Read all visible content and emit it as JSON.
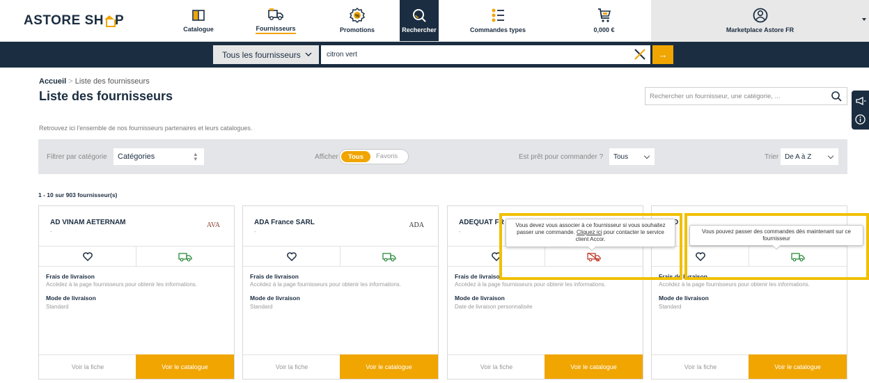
{
  "brand": {
    "logo_left": "ASTORE SH",
    "logo_right": "P"
  },
  "nav": {
    "catalogue": "Catalogue",
    "fournisseurs": "Fournisseurs",
    "promotions": "Promotions",
    "rechercher": "Rechercher",
    "commandes_types": "Commandes types",
    "cart_amount": "0,000 €",
    "user": "Marketplace Astore FR"
  },
  "search": {
    "scope": "Tous les fournisseurs",
    "query": "citron vert",
    "go": "→"
  },
  "page": {
    "breadcrumb_home": "Accueil",
    "breadcrumb_sep": ">",
    "breadcrumb_current": "Liste des fournisseurs",
    "title": "Liste des fournisseurs",
    "supplier_search_placeholder": "Rechercher un fournisseur, une catégorie, ...",
    "intro": "Retrouvez ici l'ensemble de nos fournisseurs partenaires et leurs catalogues."
  },
  "filters": {
    "category_label": "Filtrer par catégorie",
    "category_value": "Catégories",
    "show_label": "Afficher",
    "show_all": "Tous",
    "show_fav": "Favoris",
    "ready_label": "Est prêt pour commander ?",
    "ready_value": "Tous",
    "sort_label": "Trier",
    "sort_value": "De A à Z"
  },
  "results_count": "1 - 10 sur 903 fournisseur(s)",
  "cards": [
    {
      "name": "AD VINAM AETERNAM",
      "dash": "-",
      "logo": "AVA",
      "shipping_fee_title": "Frais de livraison",
      "shipping_fee_text": "Accédez à la page fournisseurs pour obtenir les informations.",
      "delivery_mode_title": "Mode de livraison",
      "delivery_mode_text": "Standard",
      "btn_fiche": "Voir la fiche",
      "btn_catalogue": "Voir le catalogue"
    },
    {
      "name": "ADA France SARL",
      "dash": "-",
      "logo": "ADA",
      "shipping_fee_title": "Frais de livraison",
      "shipping_fee_text": "Accédez à la page fournisseurs pour obtenir les informations.",
      "delivery_mode_title": "Mode de livraison",
      "delivery_mode_text": "Standard",
      "btn_fiche": "Voir la fiche",
      "btn_catalogue": "Voir le catalogue"
    },
    {
      "name": "ADEQUAT FR",
      "dash": "-",
      "logo": "",
      "shipping_fee_title": "Frais de livraiso",
      "shipping_fee_text": "Accédez à la page fournisseurs pour obtenir les informations.",
      "delivery_mode_title": "Mode de livraison",
      "delivery_mode_text": "Date de livraison personnalisée",
      "btn_fiche": "Voir la fiche",
      "btn_catalogue": "Voir le catalogue"
    },
    {
      "name": "...ED",
      "dash": "",
      "logo": "",
      "shipping_fee_title": "Frais de livraison",
      "shipping_fee_text": "Accédez à la page fournisseurs pour obtenir les informations.",
      "delivery_mode_title": "Mode de livraison",
      "delivery_mode_text": "Standard",
      "btn_fiche": "Voir la fiche",
      "btn_catalogue": "Voir le catalogue"
    }
  ],
  "tooltips": {
    "must_associate_part1": "Vous devez vous associer à ce fournisseur si vous souhaitez passer une commande.",
    "must_associate_link": "Cliquez ici",
    "must_associate_part2": "pour contacter le service client Accor.",
    "can_order": "Vous pouvez passer des commandes dès maintenant sur ce fournisseur"
  },
  "colors": {
    "navy": "#1b2d40",
    "accent": "#f0a500",
    "highlight": "#f0c000"
  }
}
